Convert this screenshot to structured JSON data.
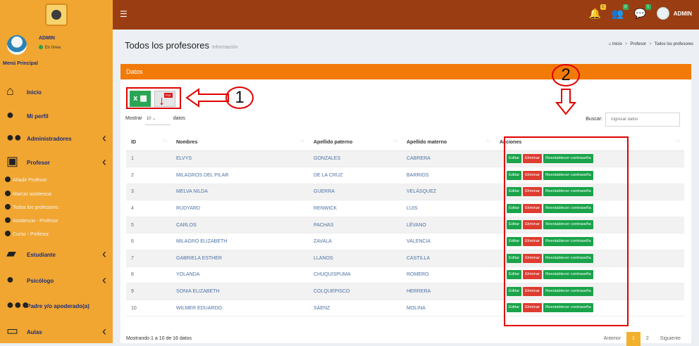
{
  "topbar": {
    "menu_icon": "☰",
    "admin_label": "ADMIN",
    "badges": [
      "1",
      "0",
      "1"
    ]
  },
  "sidebar": {
    "user": {
      "name": "ADMIN",
      "status": "En línea"
    },
    "menu_title": "Menú Principal",
    "items": [
      {
        "label": "Inicio",
        "icon": "home-icon",
        "chev": false
      },
      {
        "label": "Mi perfil",
        "icon": "user-icon",
        "chev": false
      },
      {
        "label": "Administradores",
        "icon": "group-icon",
        "chev": true
      },
      {
        "label": "Profesor",
        "icon": "teacher-icon",
        "chev": true
      },
      {
        "label": "Estudiante",
        "icon": "student-icon",
        "chev": true
      },
      {
        "label": "Psicólogo",
        "icon": "psychologist-icon",
        "chev": true
      },
      {
        "label": "Padre y/o apoderado(a)",
        "icon": "family-icon",
        "chev": false
      },
      {
        "label": "Aulas",
        "icon": "classroom-icon",
        "chev": true
      }
    ],
    "submenu": [
      "Añadir Profesor",
      "Marcar asistencia",
      "Todos los profesores",
      "Asistencia - Profesor",
      "Curso - Profesor"
    ]
  },
  "header": {
    "title": "Todos los profesores",
    "subtitle": "Información",
    "breadcrumb": [
      "Inicio",
      "Profesor",
      "Todos los profesores"
    ]
  },
  "box": {
    "title": "Datos",
    "excel_label": "x",
    "annotation_1": "1",
    "annotation_2": "2",
    "length": {
      "prefix": "Mostrar",
      "value": "10",
      "suffix": "datos"
    },
    "search": {
      "label": "Buscar:",
      "placeholder": "Ingresar datos"
    },
    "columns": [
      "ID",
      "Nombres",
      "Apellido paterno",
      "Apellido materno",
      "Acciones"
    ],
    "rows": [
      [
        "1",
        "ELVYS",
        "GONZALES",
        "CABRERA"
      ],
      [
        "2",
        "MILAGROS DEL PILAR",
        "DE LA CRUZ",
        "BARRIOS"
      ],
      [
        "3",
        "MELVA NILDA",
        "GUERRA",
        "VELÁSQUEZ"
      ],
      [
        "4",
        "RUDYARD",
        "RENWICK",
        "LUIS"
      ],
      [
        "5",
        "CARLOS",
        "PACHAS",
        "LÉVANO"
      ],
      [
        "6",
        "MILAGRO ELIZABETH",
        "ZAVALA",
        "VALENCIA"
      ],
      [
        "7",
        "GABRIELA ESTHER",
        "LLANOS",
        "CASTILLA"
      ],
      [
        "8",
        "YOLANDA",
        "CHUQUISPUMA",
        "ROMERO"
      ],
      [
        "9",
        "SONIA ELIZABETH",
        "COLQUEPISCO",
        "HERRERA"
      ],
      [
        "10",
        "WILMER EDUARDO",
        "SÁENZ",
        "MOLINA"
      ]
    ],
    "actions": [
      "Editar",
      "Eliminar",
      "Reestablecer contraseña"
    ],
    "footer": "Mostrando 1 a 10 de 16 datos",
    "pagination": [
      "Anterior",
      "1",
      "2",
      "Siguiente"
    ]
  },
  "colors": {
    "accent": "#f27a08",
    "sidebar": "#f1a631",
    "topbar": "#9b3d12",
    "highlight": "#e00000"
  }
}
